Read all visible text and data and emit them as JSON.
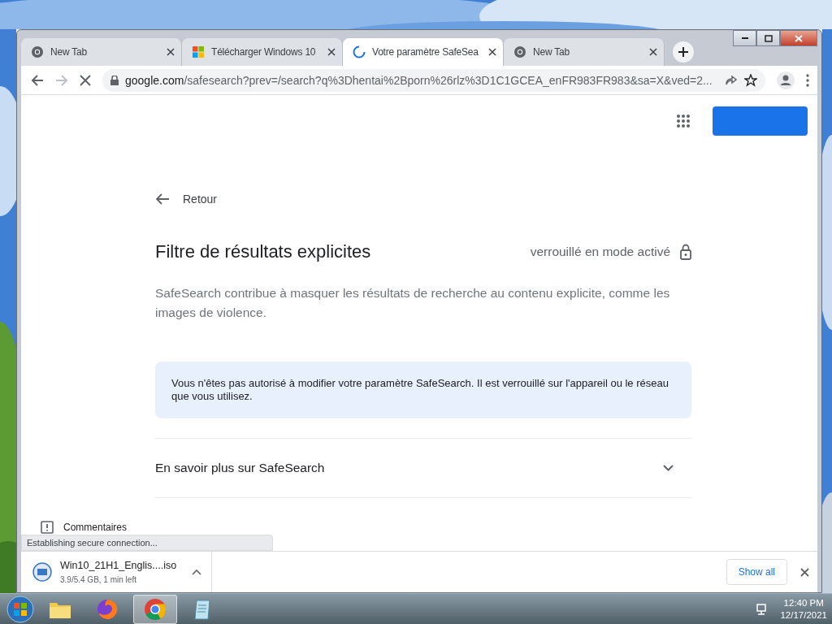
{
  "tabs": [
    {
      "label": "New Tab",
      "kind": "chrome",
      "selected": false
    },
    {
      "label": "Télécharger Windows 10",
      "kind": "windows",
      "selected": false
    },
    {
      "label": "Votre paramètre SafeSea",
      "kind": "spinner",
      "selected": true
    },
    {
      "label": "New Tab",
      "kind": "chrome",
      "selected": false
    }
  ],
  "toolbar": {
    "loading": true,
    "host": "google.com",
    "path": "/safesearch?prev=/search?q%3Dhentai%2Bporn%26rlz%3D1C1GCEA_enFR983FR983&sa=X&ved=2..."
  },
  "page": {
    "back_link": "Retour",
    "title": "Filtre de résultats explicites",
    "lock_status": "verrouillé en mode activé",
    "description": "SafeSearch contribue à masquer les résultats de recherche au contenu explicite, comme les images de violence.",
    "notice": "Vous n'êtes pas autorisé à modifier votre paramètre SafeSearch. Il est verrouillé sur l'appareil ou le réseau que vous utilisez.",
    "expander": {
      "label": "En savoir plus sur SafeSearch",
      "expanded": false
    },
    "feedback": "Commentaires"
  },
  "status_text": "Establishing secure connection...",
  "download": {
    "filename": "Win10_21H1_Englis....iso",
    "progress": "3.9/5.4 GB, 1 min left",
    "show_all": "Show all"
  },
  "taskbar": {
    "apps": [
      {
        "kind": "folder",
        "selected": false
      },
      {
        "kind": "firefox",
        "selected": false
      },
      {
        "kind": "chrome",
        "selected": true
      },
      {
        "kind": "notepad",
        "selected": false
      }
    ],
    "time": "12:40 PM",
    "date": "12/17/2021"
  }
}
